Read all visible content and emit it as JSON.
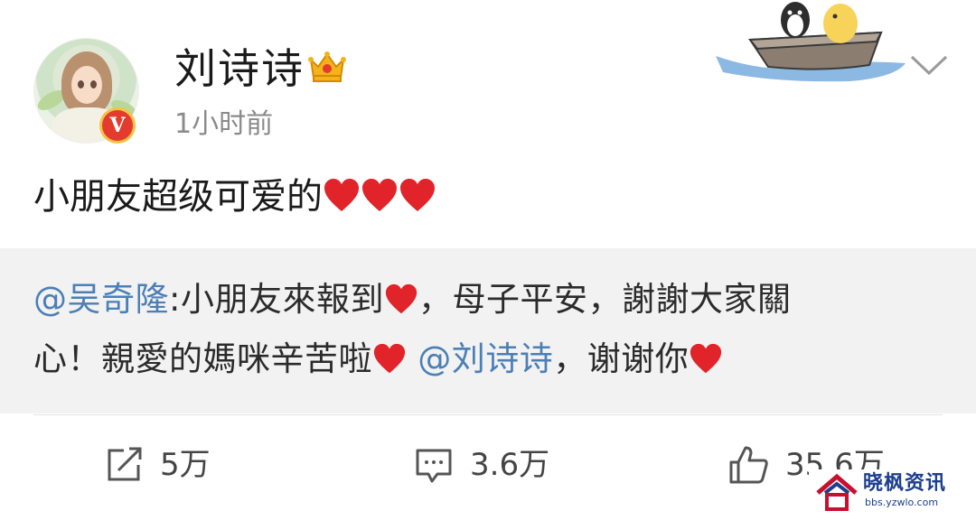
{
  "post": {
    "username": "刘诗诗",
    "timestamp": "1小时前",
    "body_text": "小朋友超级可爱的"
  },
  "quote": {
    "mention1": "@吴奇隆",
    "line1_text": ":小朋友來報到",
    "line1_tail": "，母子平安，謝謝大家關",
    "line2_text": "心！親愛的媽咪辛苦啦",
    "mention2": "@刘诗诗",
    "line2_tail": "，谢谢你"
  },
  "actions": {
    "share_count": "5万",
    "comment_count": "3.6万",
    "like_count": "35.6万"
  },
  "watermark": {
    "title": "晓枫资讯",
    "url": "bbs.yzwlo.com"
  },
  "icons": {
    "verified": "verified-v-badge-icon",
    "crown": "crown-icon",
    "chevron": "chevron-down-icon",
    "share": "share-icon",
    "comment": "comment-icon",
    "like": "thumbs-up-icon",
    "heart": "heart-icon"
  },
  "colors": {
    "mention": "#4b7fb6",
    "heart": "#e0242a",
    "verified_badge": "#e33b2e",
    "quote_bg": "#f2f2f2"
  }
}
